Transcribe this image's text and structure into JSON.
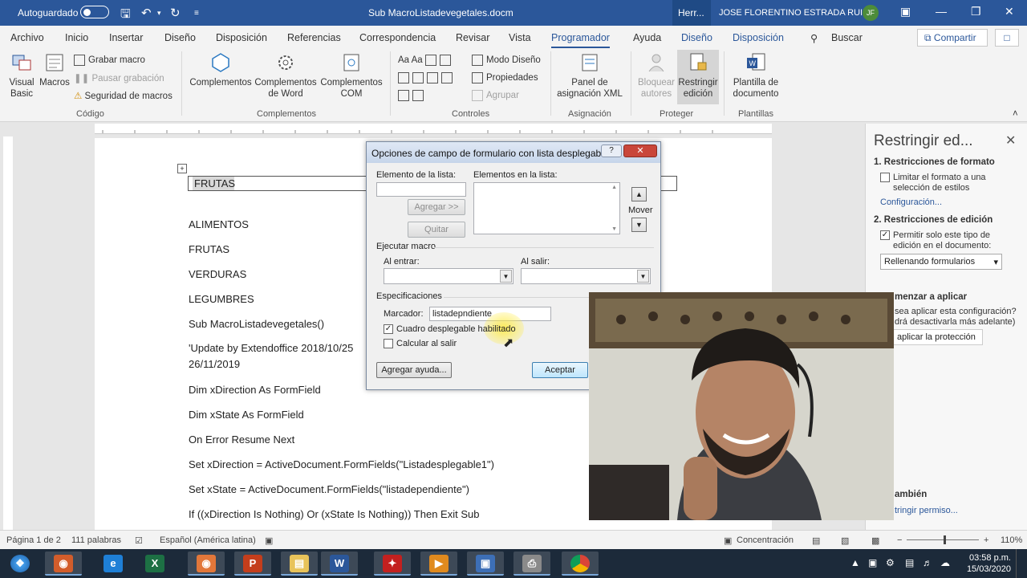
{
  "titlebar": {
    "autosave": "Autoguardado",
    "doc_title": "Sub MacroListadevegetales.docm",
    "tools": "Herr...",
    "user": "JOSE FLORENTINO ESTRADA RUIZ",
    "initials": "JF"
  },
  "tabs": [
    "Archivo",
    "Inicio",
    "Insertar",
    "Diseño",
    "Disposición",
    "Referencias",
    "Correspondencia",
    "Revisar",
    "Vista",
    "Programador",
    "Ayuda",
    "Diseño",
    "Disposición"
  ],
  "search": "Buscar",
  "share": "Compartir",
  "ribbon": {
    "visual_basic": "Visual Basic",
    "macros": "Macros",
    "record_macro": "Grabar macro",
    "pause_recording": "Pausar grabación",
    "macro_security": "Seguridad de macros",
    "group_code": "Código",
    "addins": "Complementos",
    "word_addins": "Complementos de Word",
    "com_addins": "Complementos COM",
    "group_addins": "Complementos",
    "design_mode": "Modo Diseño",
    "properties": "Propiedades",
    "group": "Agrupar",
    "group_controls": "Controles",
    "xml_panel": "Panel de asignación XML",
    "group_mapping": "Asignación",
    "block_authors": "Bloquear autores",
    "restrict_editing": "Restringir edición",
    "group_protect": "Proteger",
    "document_template": "Plantilla de documento",
    "group_templates": "Plantillas"
  },
  "document": {
    "field_value": "FRUTAS",
    "lines": [
      "ALIMENTOS",
      "FRUTAS",
      "VERDURAS",
      "LEGUMBRES",
      "Sub MacroListadevegetales()",
      "'Update by Extendoffice 2018/10/25",
      "26/11/2019",
      "Dim xDirection As FormField",
      "Dim xState As FormField",
      "On Error Resume Next",
      "Set xDirection = ActiveDocument.FormFields(\"Listadesplegable1\")",
      "Set xState = ActiveDocument.FormFields(\"listadependiente\")",
      "If ((xDirection Is Nothing) Or (xState Is Nothing)) Then Exit Sub"
    ]
  },
  "dialog": {
    "title": "Opciones de campo de formulario con lista desplegable",
    "list_item_label": "Elemento de la lista:",
    "items_in_list_label": "Elementos en la lista:",
    "add_button": "Agregar >>",
    "remove_button": "Quitar",
    "move_label": "Mover",
    "run_macro_label": "Ejecutar macro",
    "on_entry_label": "Al entrar:",
    "on_exit_label": "Al salir:",
    "specs_label": "Especificaciones",
    "bookmark_label": "Marcador:",
    "bookmark_value": "listadepndiente",
    "dropdown_enabled_label": "Cuadro desplegable habilitado",
    "dropdown_enabled": true,
    "calc_on_exit_label": "Calcular al salir",
    "calc_on_exit": false,
    "add_help_button": "Agregar ayuda...",
    "ok_button": "Aceptar"
  },
  "pane": {
    "title": "Restringir ed...",
    "section1": "1. Restricciones de formato",
    "limit_format": "Limitar el formato a una selección de estilos",
    "config_link": "Configuración...",
    "section2": "2. Restricciones de edición",
    "allow_only": "Permitir solo este tipo de edición en el documento:",
    "editing_type": "Rellenando formularios",
    "start_enforcing": "menzar a aplicar",
    "apply_question": "sea aplicar esta configuración?",
    "apply_note": "drá desactivarla más adelante)",
    "apply_protection": "aplicar la protección",
    "also": "ambién",
    "restrict_permission": "tringir permiso..."
  },
  "status": {
    "page": "Página 1 de 2",
    "words": "111 palabras",
    "language": "Español (América latina)",
    "focus": "Concentración",
    "zoom": "110%"
  },
  "taskbar": {
    "time": "03:58 p.m.",
    "date": "15/03/2020"
  },
  "colors": {
    "word_blue": "#2b579a",
    "status_bg": "#f3f3f3"
  }
}
